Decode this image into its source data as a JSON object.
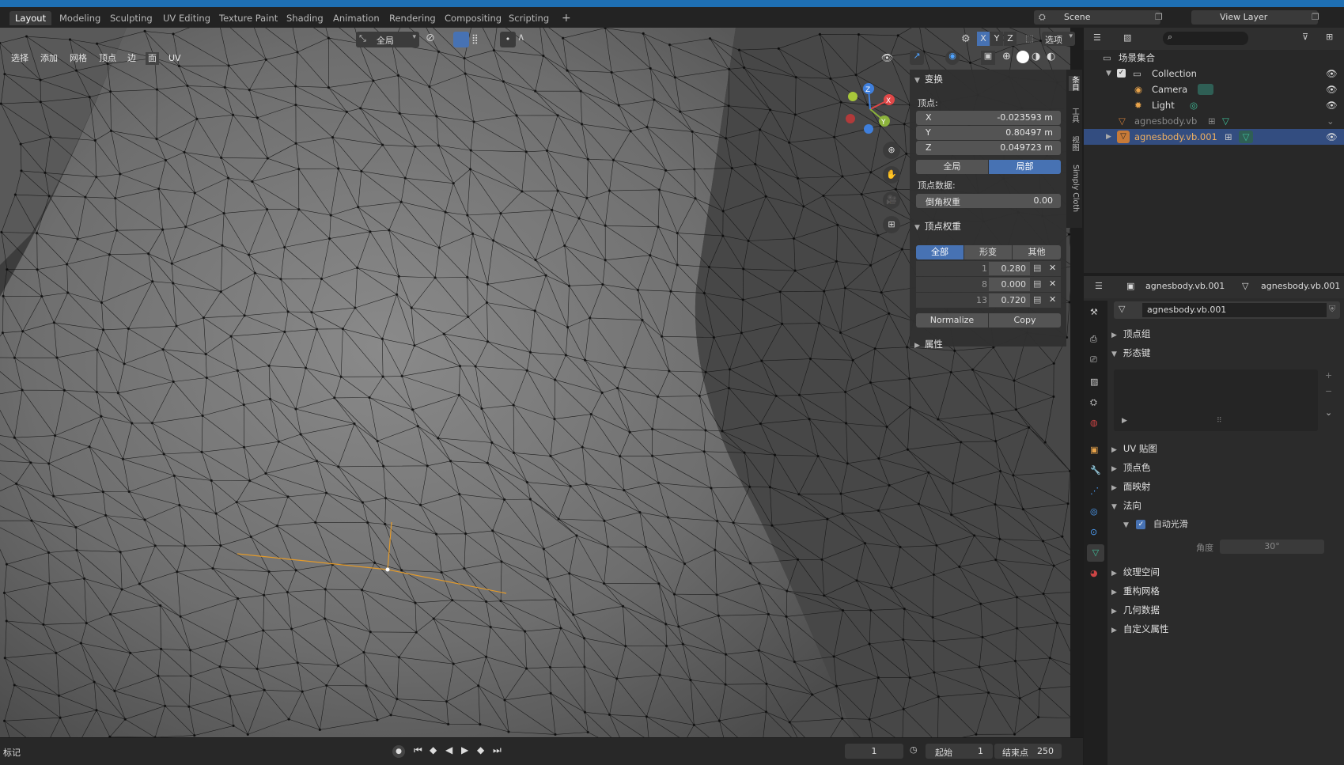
{
  "workspace_tabs": [
    "Layout",
    "Modeling",
    "Sculpting",
    "UV Editing",
    "Texture Paint",
    "Shading",
    "Animation",
    "Rendering",
    "Compositing",
    "Scripting"
  ],
  "scene": "Scene",
  "view_layer": "View Layer",
  "viewport": {
    "orientation": "全局",
    "menus": [
      "选择",
      "添加",
      "网格",
      "顶点",
      "边",
      "面",
      "UV"
    ],
    "axes": [
      "X",
      "Y",
      "Z"
    ],
    "options": "选项",
    "gizmo_axes": [
      "X",
      "Y",
      "Z"
    ]
  },
  "npanel": {
    "transform_title": "变换",
    "vertex_label": "顶点:",
    "x_label": "X",
    "x_value": "-0.023593 m",
    "y_label": "Y",
    "y_value": "0.80497 m",
    "z_label": "Z",
    "z_value": "0.049723 m",
    "global_btn": "全局",
    "local_btn": "局部",
    "vertex_data_label": "顶点数据:",
    "bevel_label": "倒角权重",
    "bevel_value": "0.00",
    "weights_title": "顶点权重",
    "weight_tabs": [
      "全部",
      "形变",
      "其他"
    ],
    "weights": [
      {
        "index": "1",
        "value": "0.280"
      },
      {
        "index": "8",
        "value": "0.000"
      },
      {
        "index": "13",
        "value": "0.720"
      }
    ],
    "normalize_btn": "Normalize",
    "copy_btn": "Copy",
    "attributes_title": "属性"
  },
  "side_tabs": [
    "条目",
    "工具",
    "视图",
    "Simply Cloth"
  ],
  "outliner": {
    "root": "场景集合",
    "collection": "Collection",
    "camera": "Camera",
    "light": "Light",
    "obj1": "agnesbody.vb",
    "obj2": "agnesbody.vb.001"
  },
  "properties": {
    "object_name": "agnesbody.vb.001",
    "mesh_name": "agnesbody.vb.001",
    "data_name": "agnesbody.vb.001",
    "sections": {
      "vertex_groups": "顶点组",
      "shape_keys": "形态键",
      "uv_maps": "UV 贴图",
      "vertex_colors": "顶点色",
      "face_maps": "面映射",
      "normals": "法向",
      "auto_smooth": "自动光滑",
      "angle_label": "角度",
      "angle_value": "30°",
      "texture_space": "纹理空间",
      "remesh": "重构网格",
      "geometry_data": "几何数据",
      "custom_props": "自定义属性"
    }
  },
  "timeline": {
    "marker": "标记",
    "current_frame": "1",
    "start_label": "起始",
    "start_value": "1",
    "end_label": "结束点",
    "end_value": "250"
  },
  "colors": {
    "accent": "#4772b3",
    "top_strip": "#1e6fb3",
    "selected_row": "#334d80"
  }
}
